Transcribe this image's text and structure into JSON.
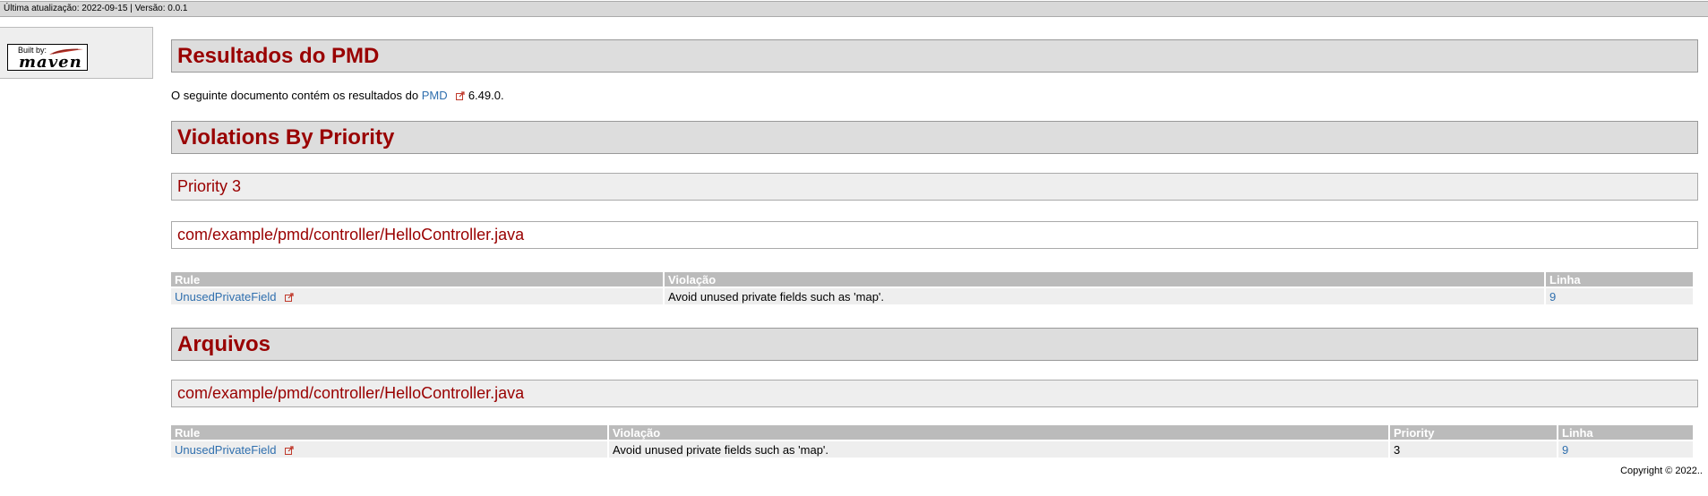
{
  "topbar": {
    "text": "Última atualização: 2022-09-15 | Versão: 0.0.1"
  },
  "logo": {
    "built_by": "Built by:",
    "maven": "maven"
  },
  "main": {
    "title": "Resultados do PMD",
    "intro_prefix": "O seguinte documento contém os resultados do",
    "intro_link": "PMD",
    "intro_version": "6.49.0.",
    "violations_title": "Violations By Priority",
    "priority_title": "Priority 3",
    "priority_file": "com/example/pmd/controller/HelloController.java",
    "files_title": "Arquivos",
    "files_file": "com/example/pmd/controller/HelloController.java"
  },
  "table1": {
    "headers": [
      "Rule",
      "Violação",
      "Linha"
    ],
    "rows": [
      {
        "rule": "UnusedPrivateField",
        "violation": "Avoid unused private fields such as 'map'.",
        "line": "9"
      }
    ]
  },
  "table2": {
    "headers": [
      "Rule",
      "Violação",
      "Priority",
      "Linha"
    ],
    "rows": [
      {
        "rule": "UnusedPrivateField",
        "violation": "Avoid unused private fields such as 'map'.",
        "priority": "3",
        "line": "9"
      }
    ]
  },
  "footer": {
    "copyright": "Copyright © 2022.."
  },
  "colors": {
    "heading": "#990000",
    "link": "#2f6fae",
    "header_bg": "#dddddd",
    "table_header": "#bbbbbb"
  },
  "icons": {
    "external_link": "external-link-icon"
  }
}
